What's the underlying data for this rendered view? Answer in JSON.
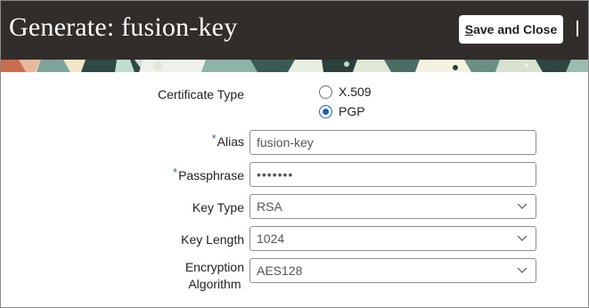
{
  "header": {
    "title": "Generate: fusion-key",
    "save_mnemonic": "S",
    "save_rest": "ave and Close"
  },
  "form": {
    "certificate_type": {
      "label": "Certificate Type",
      "options": [
        {
          "label": "X.509",
          "selected": false
        },
        {
          "label": "PGP",
          "selected": true
        }
      ]
    },
    "alias": {
      "label": "Alias",
      "required_mark": "*",
      "value": "fusion-key"
    },
    "passphrase": {
      "label": "Passphrase",
      "required_mark": "*",
      "value": "•••••••"
    },
    "key_type": {
      "label": "Key Type",
      "value": "RSA"
    },
    "key_length": {
      "label": "Key Length",
      "value": "1024"
    },
    "encryption_algorithm": {
      "label_line1": "Encryption",
      "label_line2": "Algorithm",
      "value": "AES128"
    }
  },
  "colors": {
    "header_bg": "#312d2a",
    "accent": "#1a5fb4",
    "required": "#2e6bb3"
  },
  "icons": {
    "select_arrow": "chevron-down-icon",
    "overflow": "overflow-separator-icon"
  }
}
